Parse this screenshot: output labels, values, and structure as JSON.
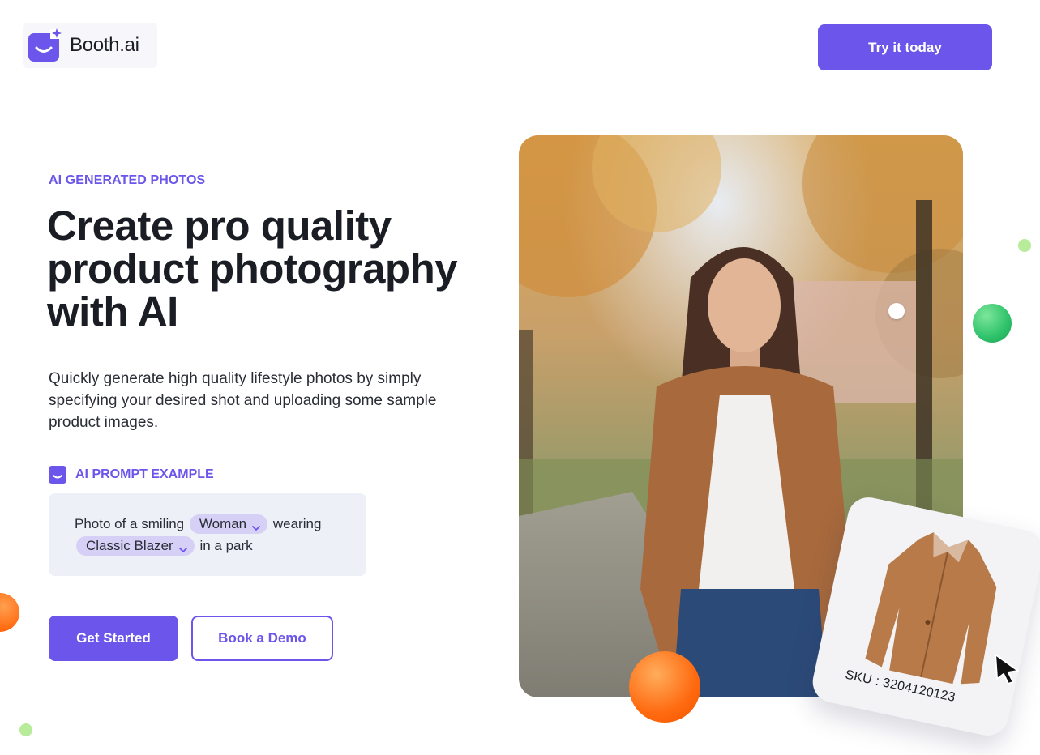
{
  "header": {
    "logo_text": "Booth.ai",
    "cta_label": "Try it today"
  },
  "hero": {
    "eyebrow": "AI GENERATED PHOTOS",
    "headline_line1": "Create pro quality",
    "headline_line2": "product photography",
    "headline_line3": "with AI",
    "subtext": "Quickly generate high quality lifestyle photos by simply specifying your desired shot and uploading some sample product images.",
    "prompt_label": "AI PROMPT EXAMPLE",
    "prompt": {
      "text_1": "Photo of a smiling",
      "chip_1": "Woman",
      "text_2": "wearing",
      "chip_2": "Classic Blazer",
      "text_3": "in a park"
    },
    "primary_button": "Get Started",
    "secondary_button": "Book a Demo"
  },
  "product_card": {
    "sku": "SKU : 3204120123"
  },
  "colors": {
    "brand": "#6b55ea",
    "chip": "#d6d0f7",
    "prompt_bg": "#edf0f7",
    "orange": "#ff6a10",
    "green": "#2ec26a",
    "light_green": "#b8eb9a"
  }
}
